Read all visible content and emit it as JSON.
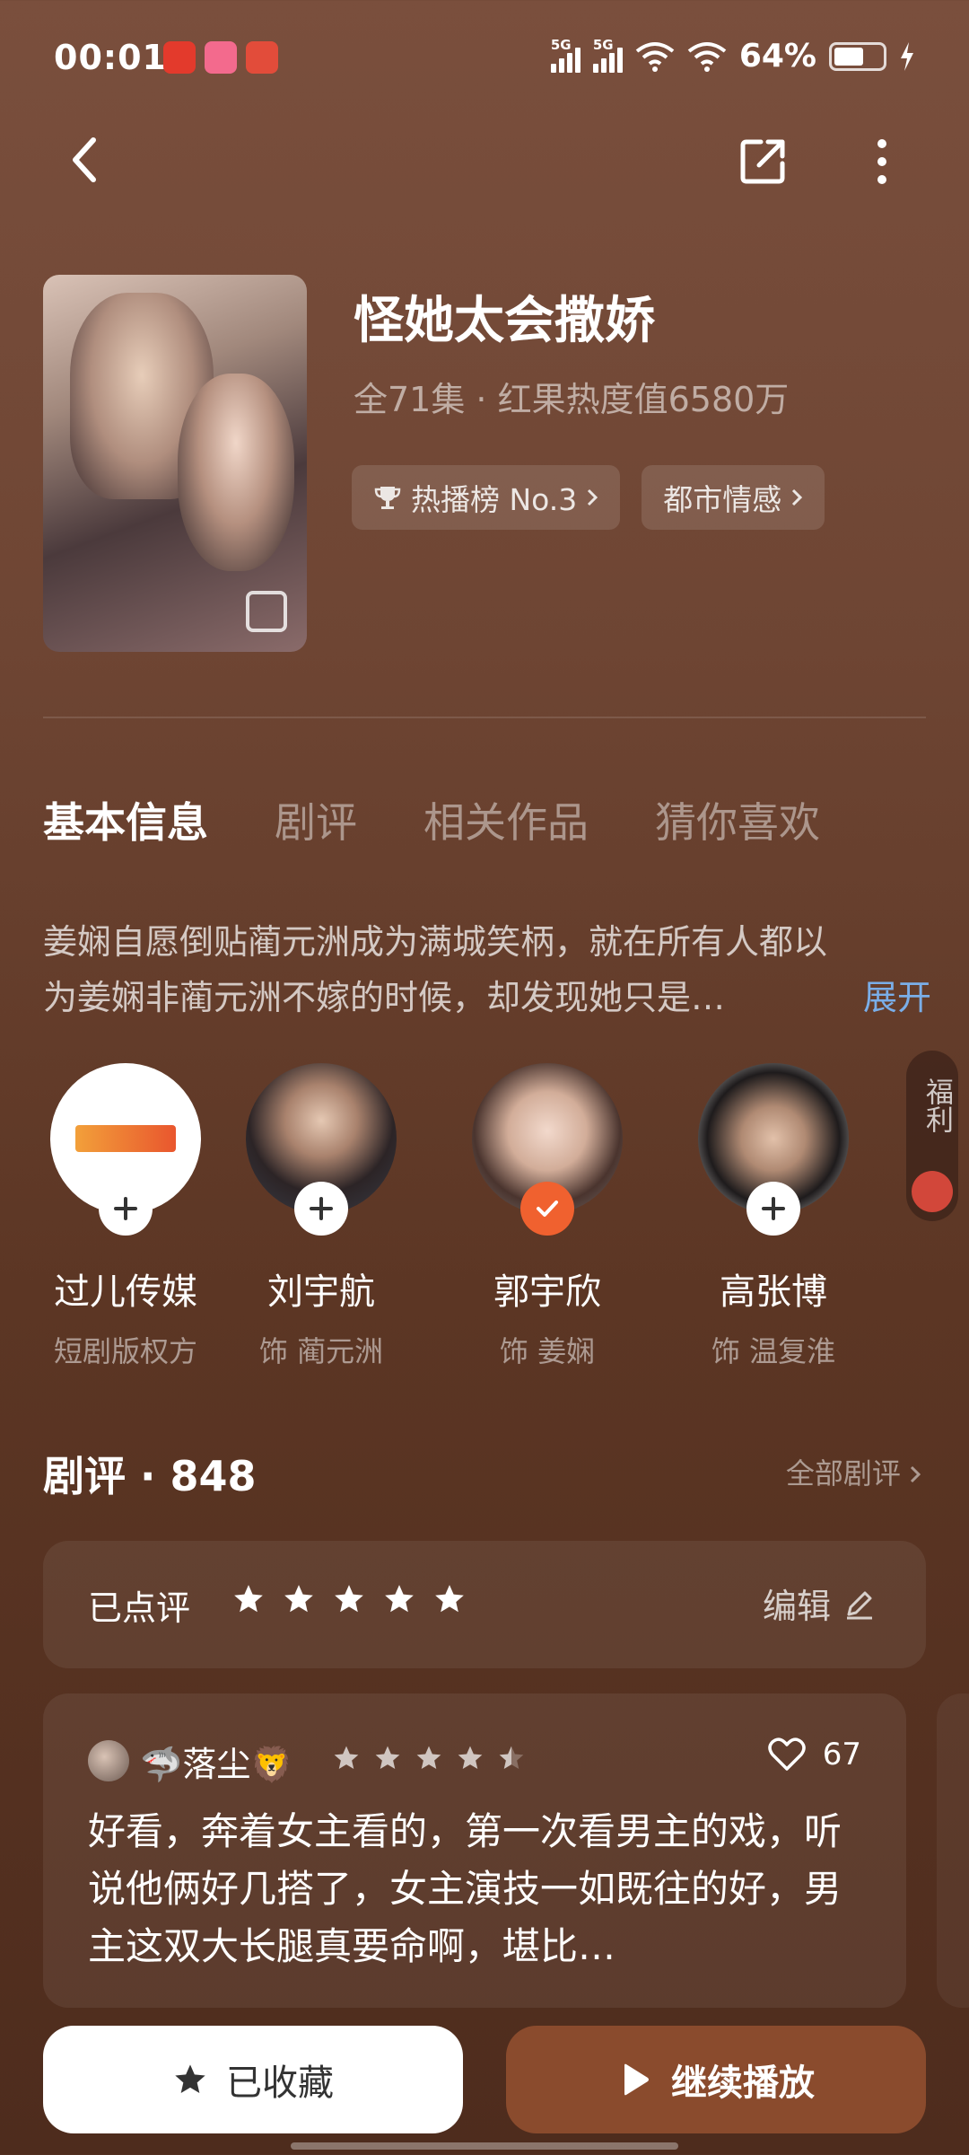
{
  "status_bar": {
    "time": "00:01",
    "network_1": "5G",
    "network_2": "5G",
    "battery": "64%"
  },
  "show": {
    "title": "怪她太会撒娇",
    "meta": "全71集 · 红果热度值6580万",
    "tags": [
      {
        "label": "热播榜 No.3",
        "icon": "trophy-icon"
      },
      {
        "label": "都市情感",
        "icon": ""
      }
    ]
  },
  "tabs": [
    "基本信息",
    "剧评",
    "相关作品",
    "猜你喜欢"
  ],
  "synopsis": {
    "line1": "姜娴自愿倒贴蔺元洲成为满城笑柄，就在所有人都以",
    "line2": "为姜娴非蔺元洲不嫁的时候，却发现她只是…",
    "expand": "展开"
  },
  "cast": [
    {
      "name": "过儿传媒",
      "role": "短剧版权方",
      "following": false
    },
    {
      "name": "刘宇航",
      "role": "饰 蔺元洲",
      "following": false
    },
    {
      "name": "郭宇欣",
      "role": "饰 姜娴",
      "following": true
    },
    {
      "name": "高张博",
      "role": "饰 温复淮",
      "following": false
    }
  ],
  "welfare": "福利",
  "reviews": {
    "title": "剧评 · 848",
    "all_link": "全部剧评",
    "rated_label": "已点评",
    "my_rating": 5,
    "edit_label": "编辑",
    "items": [
      {
        "user": "🦈落尘🦁",
        "rating": 4.5,
        "likes": "67",
        "text": "好看，奔着女主看的，第一次看男主的戏，听说他俩好几搭了，女主演技一如既往的好，男主这双大长腿真要命啊，堪比…"
      }
    ]
  },
  "bottom_bar": {
    "favorite_label": "已收藏",
    "play_label": "继续播放"
  },
  "colors": {
    "accent": "#f0612f",
    "play_button": "#8a4b2d",
    "link": "#7aaee8"
  }
}
